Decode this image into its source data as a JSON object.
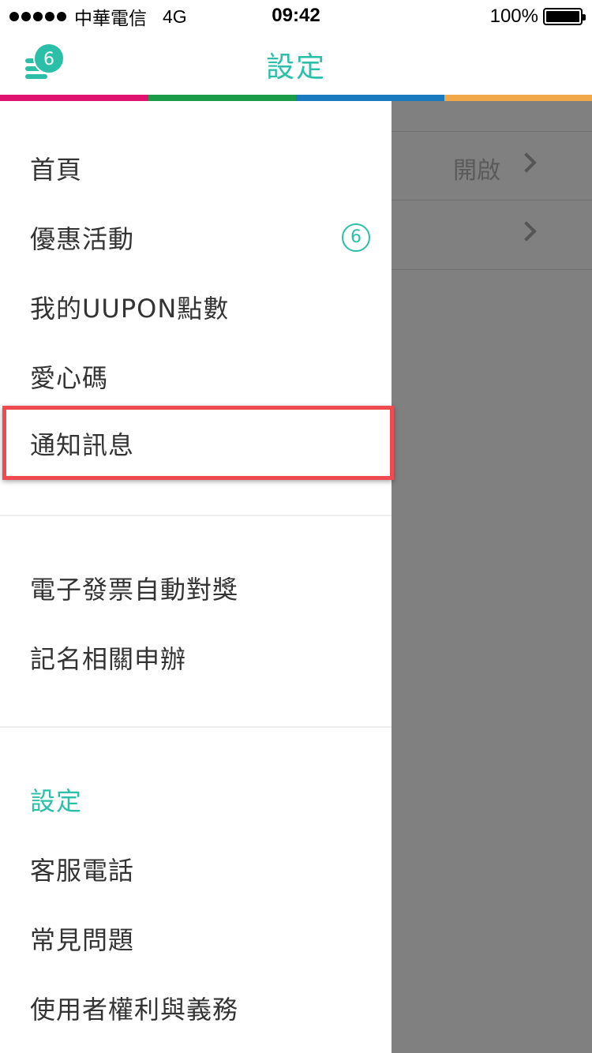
{
  "status_bar": {
    "carrier": "中華電信",
    "network": "4G",
    "time": "09:42",
    "battery": "100%"
  },
  "header": {
    "title": "設定",
    "menu_badge": "6",
    "accent_color": "#2bbfa8"
  },
  "color_strip": [
    "#e0126f",
    "#1a9b48",
    "#1a7ac0",
    "#f0a848"
  ],
  "background_rows": [
    {
      "value": "開啟"
    },
    {
      "value": ""
    }
  ],
  "drawer": {
    "items": [
      {
        "label": "首頁"
      },
      {
        "label": "優惠活動",
        "count": "6"
      },
      {
        "label": "我的UUPON點數"
      },
      {
        "label": "愛心碼"
      },
      {
        "label": "通知訊息"
      }
    ],
    "items2": [
      {
        "label": "電子發票自動對獎"
      },
      {
        "label": "記名相關申辦"
      }
    ],
    "settings_section": "設定",
    "items3": [
      {
        "label": "客服電話"
      },
      {
        "label": "常見問題"
      },
      {
        "label": "使用者權利與義務"
      }
    ]
  }
}
